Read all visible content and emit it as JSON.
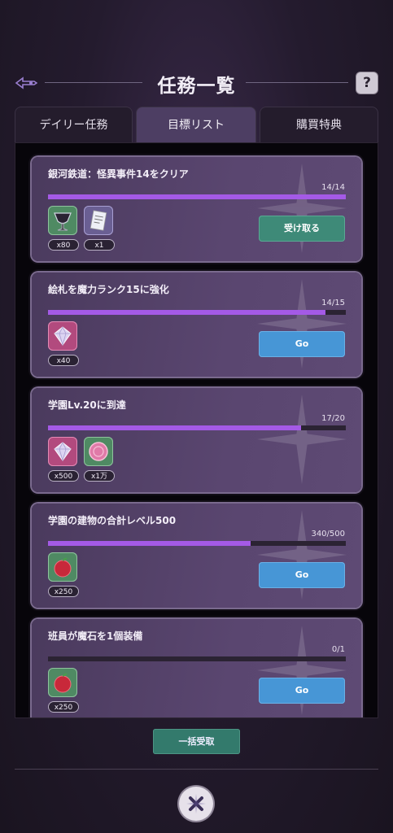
{
  "header": {
    "title": "任務一覧",
    "help_label": "?"
  },
  "tabs": [
    {
      "label": "デイリー任務",
      "active": false
    },
    {
      "label": "目標リスト",
      "active": true
    },
    {
      "label": "購買特典",
      "active": false
    }
  ],
  "tasks": [
    {
      "title": "銀河鉄道：怪異事件14をクリア",
      "progress_text": "14/14",
      "progress": 1.0,
      "rewards": [
        {
          "icon": "dark-goblet-icon",
          "qty": "x80"
        },
        {
          "icon": "document-ticket-icon",
          "qty": "x1"
        }
      ],
      "button": "受け取る",
      "button_type": "claim"
    },
    {
      "title": "絵札を魔力ランク15に強化",
      "progress_text": "14/15",
      "progress": 0.933,
      "rewards": [
        {
          "icon": "pink-gem-icon",
          "qty": "x40"
        }
      ],
      "button": "Go",
      "button_type": "go"
    },
    {
      "title": "学園Lv.20に到達",
      "progress_text": "17/20",
      "progress": 0.85,
      "rewards": [
        {
          "icon": "pink-gem-icon",
          "qty": "x500"
        },
        {
          "icon": "pink-coin-icon",
          "qty": "x1万"
        }
      ],
      "button": "",
      "button_type": "none"
    },
    {
      "title": "学園の建物の合計レベル500",
      "progress_text": "340/500",
      "progress": 0.68,
      "rewards": [
        {
          "icon": "red-apple-icon",
          "qty": "x250"
        }
      ],
      "button": "Go",
      "button_type": "go"
    },
    {
      "title": "班員が魔石を1個装備",
      "progress_text": "0/1",
      "progress": 0.0,
      "rewards": [
        {
          "icon": "red-apple-icon",
          "qty": "x250"
        }
      ],
      "button": "Go",
      "button_type": "go"
    }
  ],
  "footer": {
    "claim_all_label": "一括受取"
  },
  "colors": {
    "accent": "#a45ae6",
    "claim": "#3e8a78",
    "go": "#4796d6"
  }
}
